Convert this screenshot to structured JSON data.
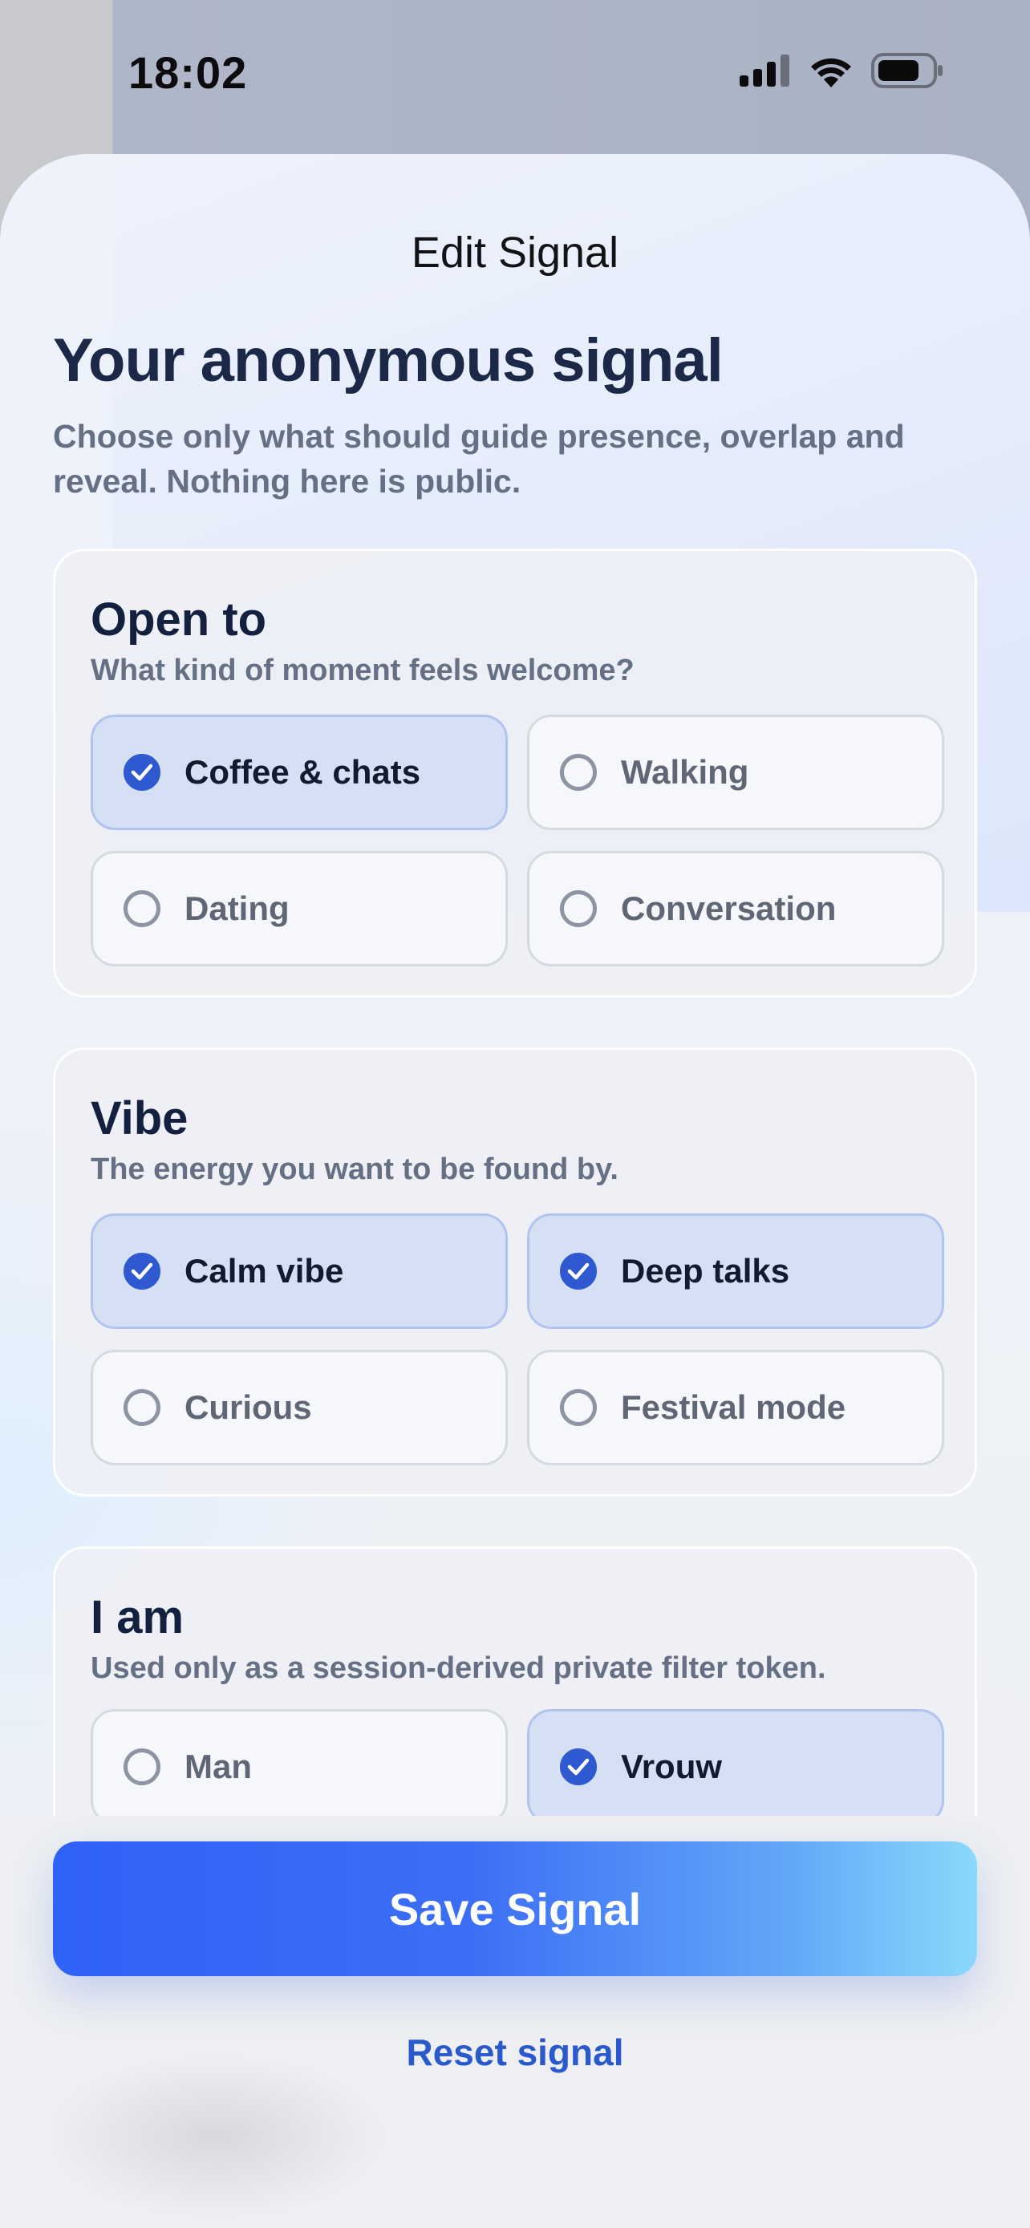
{
  "status_bar": {
    "time": "18:02",
    "icons": [
      "cellular-signal-icon",
      "wifi-icon",
      "battery-icon"
    ]
  },
  "sheet": {
    "title": "Edit Signal"
  },
  "hero": {
    "title": "Your anonymous signal",
    "subtitle": "Choose only what should guide presence, overlap and reveal. Nothing here is public."
  },
  "sections": [
    {
      "title": "Open to",
      "subtitle": "What kind of moment feels welcome?",
      "options": [
        {
          "label": "Coffee & chats",
          "selected": true
        },
        {
          "label": "Walking",
          "selected": false
        },
        {
          "label": "Dating",
          "selected": false
        },
        {
          "label": "Conversation",
          "selected": false
        }
      ]
    },
    {
      "title": "Vibe",
      "subtitle": "The energy you want to be found by.",
      "options": [
        {
          "label": "Calm vibe",
          "selected": true
        },
        {
          "label": "Deep talks",
          "selected": true
        },
        {
          "label": "Curious",
          "selected": false
        },
        {
          "label": "Festival mode",
          "selected": false
        }
      ]
    },
    {
      "title": "I am",
      "subtitle": "Used only as a session-derived private filter token.",
      "options": [
        {
          "label": "Man",
          "selected": false
        },
        {
          "label": "Vrouw",
          "selected": true
        }
      ]
    }
  ],
  "actions": {
    "save_label": "Save Signal",
    "reset_label": "Reset signal"
  },
  "colors": {
    "accent": "#2f59d0",
    "selected_bg": "#d6e0f5",
    "title_text": "#13203f",
    "muted_text": "#667085"
  }
}
